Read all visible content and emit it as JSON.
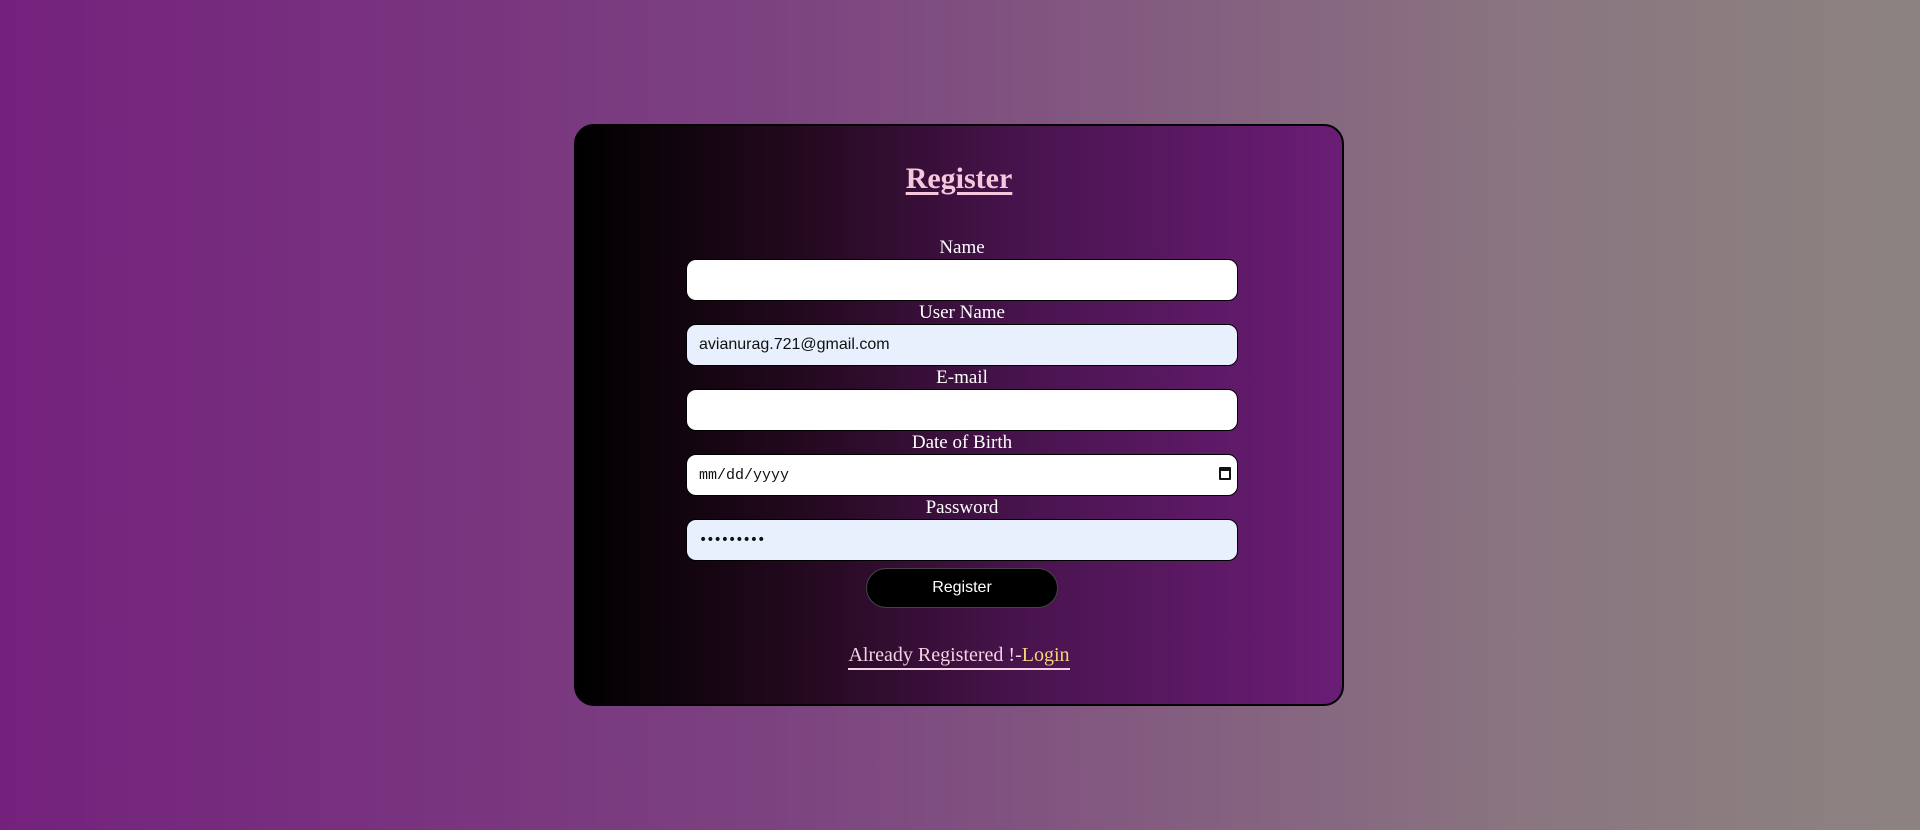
{
  "form": {
    "title": "Register",
    "fields": [
      {
        "label": "Name",
        "value": ""
      },
      {
        "label": "User Name",
        "value": "avianurag.721@gmail.com"
      },
      {
        "label": "E-mail",
        "value": ""
      },
      {
        "label": "Date of Birth",
        "placeholder": "mm/dd/yyyy"
      },
      {
        "label": "Password",
        "value": "•••••••••"
      }
    ],
    "submit_label": "Register"
  },
  "footer": {
    "text": "Already Registered !-",
    "link_label": "Login"
  },
  "icons": {
    "calendar": "calendar-icon"
  },
  "colors": {
    "title": "#f5c6dc",
    "link": "#f7d27a",
    "autofill_bg": "#e8f0fe",
    "button_bg": "#000000"
  }
}
